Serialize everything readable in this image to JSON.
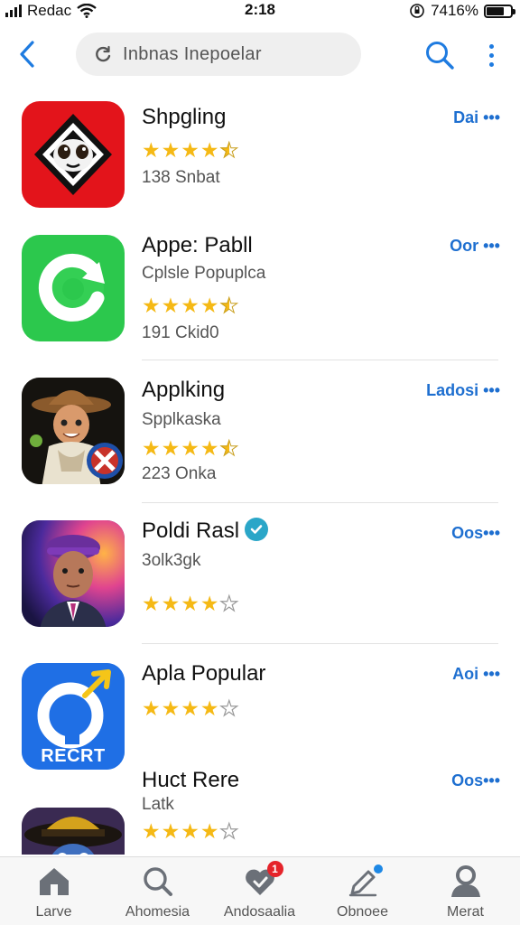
{
  "status_bar": {
    "carrier": "Redac",
    "time": "2:18",
    "battery_text": "7416%",
    "battery_level": 0.74
  },
  "header": {
    "search_text": "Inbnas Inepoelar",
    "back_icon": "chevron-left-icon",
    "search_icon": "search-icon",
    "menu_icon": "more-vertical-icon",
    "accent_color": "#1e7be0"
  },
  "apps": [
    {
      "name": "Shpgling",
      "subtitle": "",
      "rating": 4.5,
      "meta": "138 Snbat",
      "action": "Dai •••",
      "icon": "dark-mask-icon"
    },
    {
      "name": "Appe: Pabll",
      "subtitle": "Cplsle Popuplca",
      "rating": 4.5,
      "meta": "191 Ckid0",
      "action": "Oor •••",
      "icon": "green-refresh-icon"
    },
    {
      "name": "Applking",
      "subtitle": "Spplkaska",
      "rating": 4.5,
      "meta": "223 Onka",
      "action": "Ladosi •••",
      "icon": "cowboy-character-icon"
    },
    {
      "name": "Poldi Rasl",
      "subtitle": "3olk3gk",
      "rating": 4,
      "meta": "",
      "action": "Oos•••",
      "icon": "portrait-purple-cap-icon",
      "verified": true
    },
    {
      "name": "Apla Popular",
      "subtitle": "",
      "rating": 4,
      "meta": "",
      "action": "Aoi •••",
      "icon": "blue-recrt-icon",
      "icon_text": "RECRT"
    },
    {
      "name": "Huct Rere",
      "subtitle": "Latk",
      "rating": 4,
      "meta": "",
      "action": "Oos•••",
      "icon": "hat-character-icon"
    }
  ],
  "tabs": [
    {
      "label": "Larve",
      "icon": "home-icon"
    },
    {
      "label": "Ahomesia",
      "icon": "search-icon"
    },
    {
      "label": "Andosaalia",
      "icon": "heart-badge-icon",
      "badge": "1"
    },
    {
      "label": "Obnoee",
      "icon": "edit-pen-icon"
    },
    {
      "label": "Merat",
      "icon": "person-icon"
    }
  ]
}
